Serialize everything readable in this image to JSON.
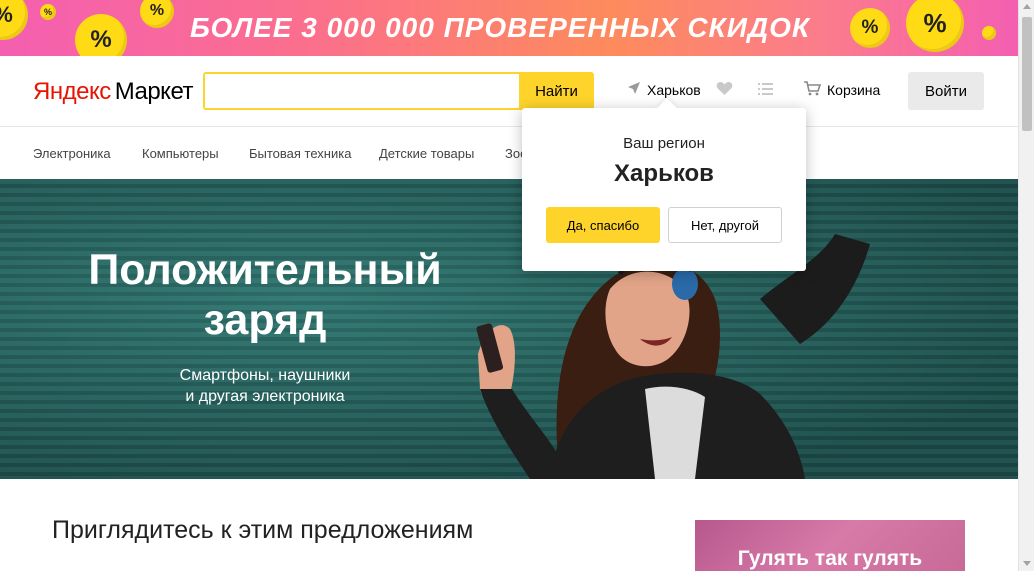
{
  "promo_banner": {
    "text": "БОЛЕЕ 3 000 000 ПРОВЕРЕННЫХ СКИДОК",
    "coin_symbol": "%",
    "colors": {
      "coin": "#ffdb16"
    }
  },
  "header": {
    "logo": {
      "part1": "Яндекс",
      "part2": "Маркет",
      "red": "#e61400"
    },
    "search": {
      "value": "",
      "placeholder": "",
      "button_label": "Найти"
    },
    "region_label": "Харьков",
    "icons": [
      "location-arrow-icon",
      "heart-icon",
      "list-icon",
      "cart-icon"
    ],
    "cart_label": "Корзина",
    "login_label": "Войти",
    "accent": "#fed42b"
  },
  "categories": [
    "Электроника",
    "Компьютеры",
    "Бытовая техника",
    "Детские товары",
    "Зоо"
  ],
  "hero": {
    "title_line1": "Положительный",
    "title_line2": "заряд",
    "subtitle_line1": "Смартфоны, наушники",
    "subtitle_line2": "и другая электроника"
  },
  "region_popup": {
    "label": "Ваш регион",
    "city": "Харьков",
    "confirm_label": "Да, спасибо",
    "decline_label": "Нет, другой"
  },
  "offers": {
    "title": "Приглядитесь к этим предложениям",
    "promo_card_text": "Гулять так гулять"
  }
}
